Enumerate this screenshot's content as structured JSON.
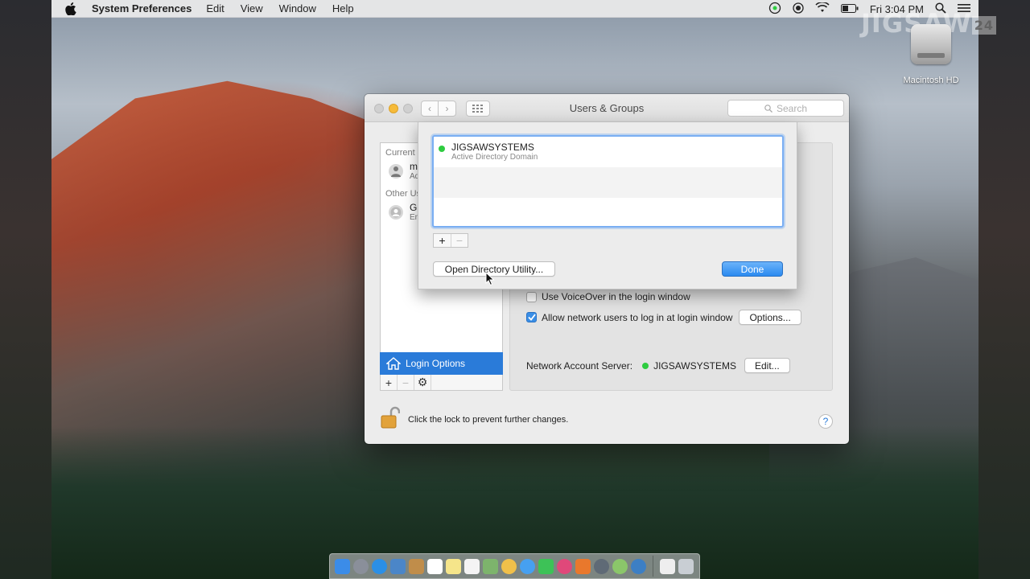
{
  "menubar": {
    "app_name": "System Preferences",
    "menus": [
      "Edit",
      "View",
      "Window",
      "Help"
    ],
    "clock": "Fri 3:04 PM"
  },
  "watermark": {
    "text": "JIGSAW",
    "badge": "24"
  },
  "desktop": {
    "drive_label": "Macintosh HD"
  },
  "window": {
    "title": "Users & Groups",
    "search_placeholder": "Search",
    "sidebar": {
      "current_label": "Current",
      "current_user_name": "ma",
      "current_user_role": "Ad",
      "other_label": "Other Us",
      "other_user_name": "Gu",
      "other_user_role": "En",
      "login_options": "Login Options"
    },
    "options": {
      "voiceover": "Use VoiceOver in the login window",
      "allow_network": "Allow network users to log in at login window",
      "options_button": "Options...",
      "server_label": "Network Account Server:",
      "server_name": "JIGSAWSYSTEMS",
      "edit_button": "Edit..."
    },
    "lock_text": "Click the lock to prevent further changes.",
    "help": "?"
  },
  "sheet": {
    "server": {
      "name": "JIGSAWSYSTEMS",
      "type": "Active Directory Domain"
    },
    "open_directory_button": "Open Directory Utility...",
    "done_button": "Done"
  },
  "colors": {
    "accent": "#2a7bd9",
    "status_online": "#2ecc40"
  }
}
